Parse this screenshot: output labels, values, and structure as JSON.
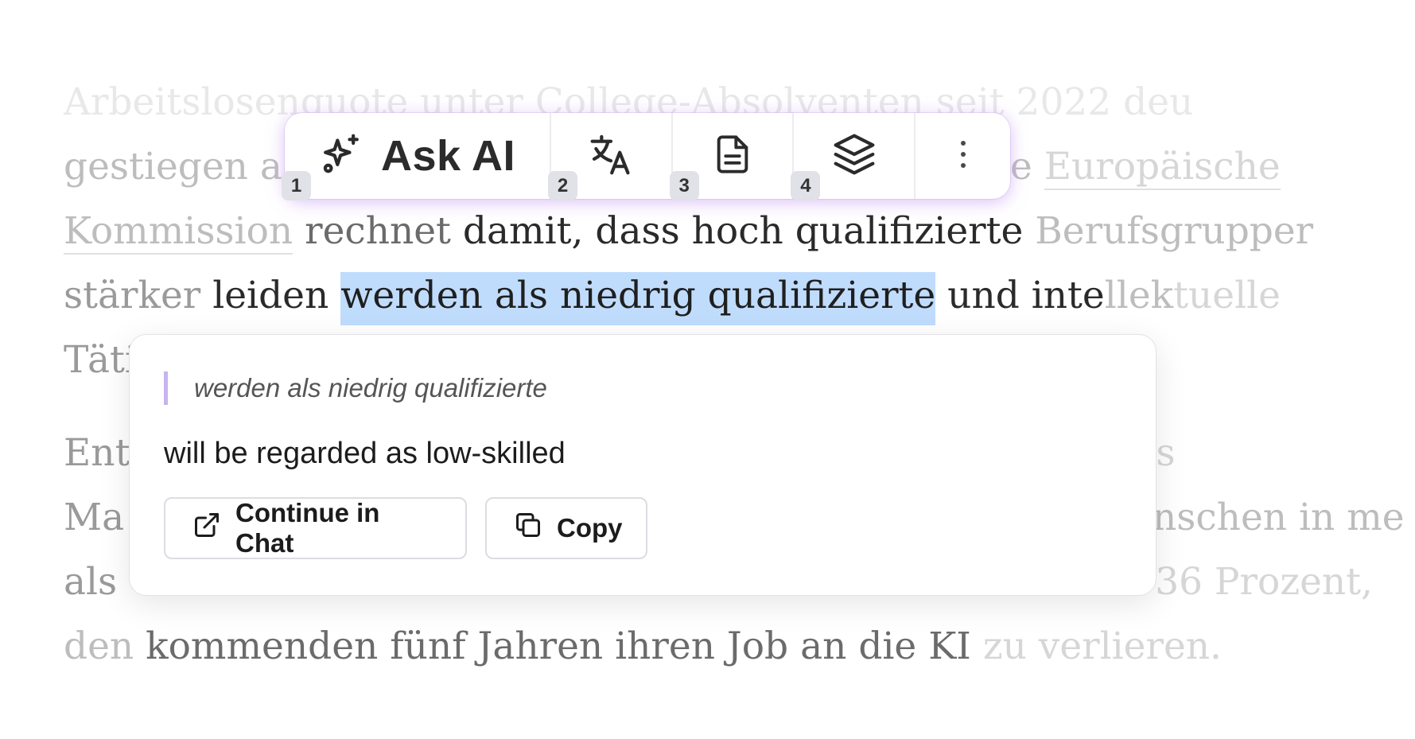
{
  "article": {
    "l1": [
      "Arbeitslosenquote unter College-Absolventen seit 2022 deu"
    ],
    "l2": [
      "gestiegen a",
      "ie ",
      "Europäische"
    ],
    "l3": [
      "Kommission",
      " rechnet ",
      "damit, dass hoch qualifizierte ",
      "Berufsgrupper"
    ],
    "l4": [
      "stärker ",
      "leiden ",
      "werden als niedrig qualifizierte",
      " und inte",
      "llek",
      "tuelle"
    ],
    "l5": [
      "Täti"
    ],
    "l6": [
      "Ent",
      "s"
    ],
    "l7": [
      "Ma",
      "enschen in me"
    ],
    "l8": [
      "als",
      "36 Prozent,"
    ],
    "l9": [
      "den ",
      "kommenden fünf Jahren ihren Job an die KI ",
      "zu verlieren."
    ]
  },
  "toolbar": {
    "ask_label": "Ask AI",
    "ask_icon": "sparkles-icon",
    "translate_icon": "translate-icon",
    "document_icon": "document-icon",
    "layers_icon": "layers-icon",
    "more_icon": "more-vertical-icon",
    "badges": [
      "1",
      "2",
      "3",
      "4"
    ],
    "glow_color": "#be8cf0"
  },
  "popup": {
    "quote": "werden als niedrig qualifizierte",
    "translation": "will be regarded as low-skilled",
    "continue_label": "Continue in Chat",
    "copy_label": "Copy",
    "quote_bar_color": "#c6b4ef"
  },
  "highlight_color": "#c0dcfd"
}
